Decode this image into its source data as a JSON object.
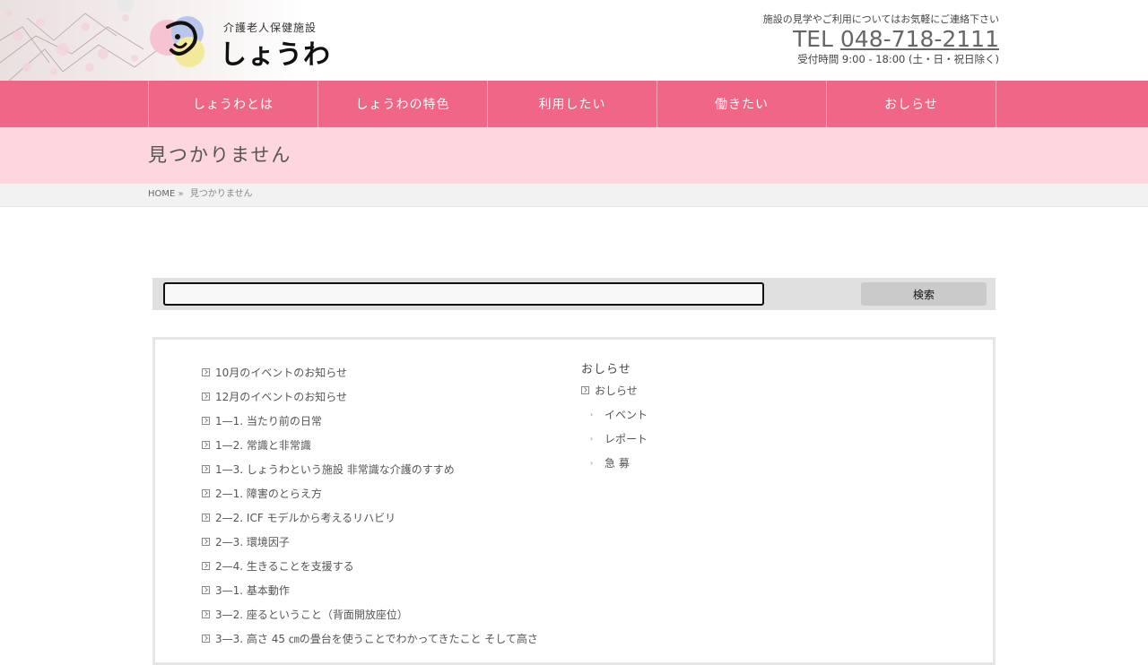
{
  "header": {
    "logo_sub": "介護老人保健施設",
    "logo_main": "しょうわ",
    "contact_note": "施設の見学やご利用についてはお気軽にご連絡下さい",
    "tel_prefix": "TEL ",
    "tel_number": "048-718-2111",
    "hours": "受付時間 9:00 - 18:00 (土・日・祝日除く)"
  },
  "nav": {
    "items": [
      "しょうわとは",
      "しょうわの特色",
      "利用したい",
      "働きたい",
      "おしらせ"
    ]
  },
  "page": {
    "title": "見つかりません"
  },
  "breadcrumb": {
    "home": "HOME",
    "sep": "»",
    "current": "見つかりません"
  },
  "search": {
    "value": "",
    "button": "検索"
  },
  "sitemap": {
    "posts": [
      "10月のイベントのお知らせ",
      "12月のイベントのお知らせ",
      "1—1. 当たり前の日常",
      "1—2. 常識と非常識",
      "1—3. しょうわという施設 非常識な介護のすすめ",
      "2—1. 障害のとらえ方",
      "2—2. ICF モデルから考えるリハビリ",
      "2—3. 環境因子",
      "2—4. 生きることを支援する",
      "3—1. 基本動作",
      "3—2. 座るということ（背面開放座位）",
      "3—3. 高さ 45 ㎝の畳台を使うことでわかってきたこと そして高さ"
    ],
    "category_title": "おしらせ",
    "category_root": "おしらせ",
    "category_children": [
      "イベント",
      "レポート",
      "急 募"
    ]
  },
  "colors": {
    "nav": "#ef6686",
    "title_band": "#fdd6de",
    "breadcrumb_bg": "#f2f2f2"
  },
  "icons": {
    "post_bullet": "square-arrow-icon",
    "sub_bullet": "arrow-right-icon"
  }
}
